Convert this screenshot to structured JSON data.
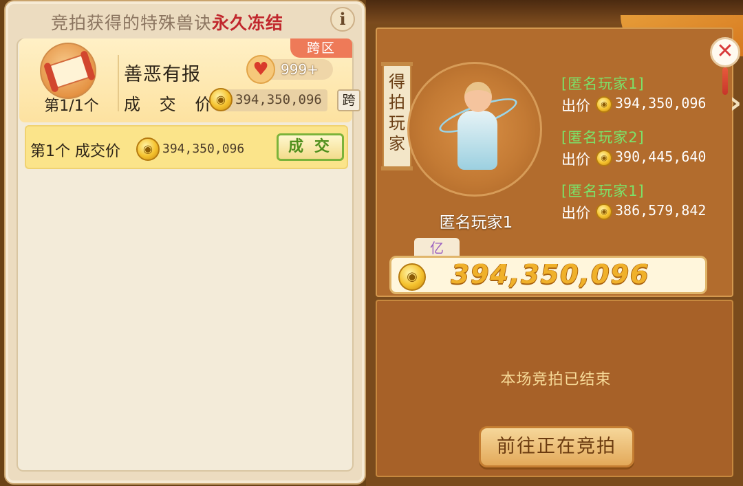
{
  "notice": {
    "prefix": "竞拍获得的特殊兽诀",
    "highlight": "永久冻结"
  },
  "info_icon": "i",
  "item": {
    "tag": "跨区",
    "count_label": "第1/1个",
    "name": "善恶有报",
    "likes": "999+",
    "price_label": "成 交 价",
    "price": "394,350,096",
    "cross_button": "跨"
  },
  "deal": {
    "label": "第1个 成交价",
    "price": "394,350,096",
    "button": "成 交"
  },
  "right": {
    "tab_label": "得拍玩家",
    "winner_name": "匿名玩家1",
    "bids": [
      {
        "player": "[匿名玩家1]",
        "label": "出价",
        "price": "394,350,096"
      },
      {
        "player": "[匿名玩家2]",
        "label": "出价",
        "price": "390,445,640"
      },
      {
        "player": "[匿名玩家1]",
        "label": "出价",
        "price": "386,579,842"
      }
    ],
    "unit": "亿",
    "final_price": "394,350,096",
    "status": "本场竞拍已结束",
    "goto_button": "前往正在竞拍",
    "close_icon": "✕"
  },
  "colors": {
    "accent_red": "#c1272d",
    "bid_green": "#7be36a",
    "gold": "#f0b12a"
  }
}
